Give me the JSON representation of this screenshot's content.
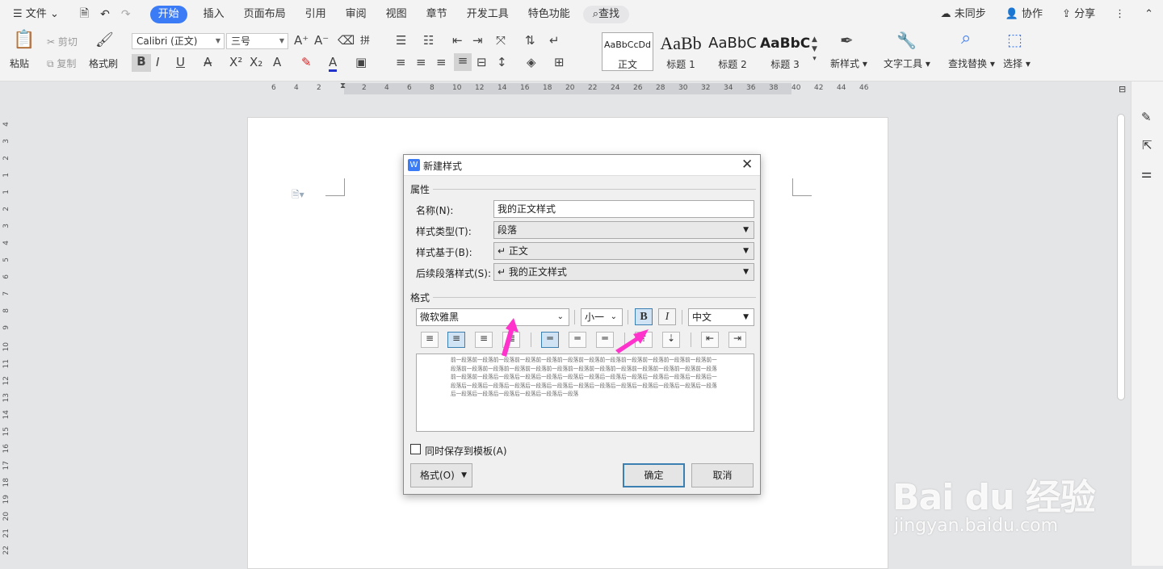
{
  "menubar": {
    "file_label": "文件",
    "tabs": [
      "开始",
      "插入",
      "页面布局",
      "引用",
      "审阅",
      "视图",
      "章节",
      "开发工具",
      "特色功能"
    ],
    "active_tab": "开始",
    "search_label": "查找",
    "sync_label": "未同步",
    "collab_label": "协作",
    "share_label": "分享"
  },
  "ribbon": {
    "paste_label": "粘贴",
    "cut_label": "剪切",
    "copy_label": "复制",
    "format_painter_label": "格式刷",
    "font_name": "Calibri (正文)",
    "font_size": "三号",
    "styles": [
      {
        "preview": "AaBbCcDd",
        "name": "正文"
      },
      {
        "preview": "AaBb",
        "name": "标题 1"
      },
      {
        "preview": "AaBbC",
        "name": "标题 2"
      },
      {
        "preview": "AaBbC",
        "name": "标题 3"
      }
    ],
    "new_style_label": "新样式",
    "text_tools_label": "文字工具",
    "find_replace_label": "查找替换",
    "select_label": "选择"
  },
  "ruler": {
    "h_ticks": [
      "6",
      "4",
      "2",
      "2",
      "4",
      "6",
      "8",
      "10",
      "12",
      "14",
      "16",
      "18",
      "20",
      "22",
      "24",
      "26",
      "28",
      "30",
      "32",
      "34",
      "36",
      "38",
      "40",
      "42",
      "44",
      "46"
    ],
    "v_ticks": [
      "4",
      "3",
      "2",
      "1",
      "1",
      "2",
      "3",
      "4",
      "5",
      "6",
      "7",
      "8",
      "9",
      "10",
      "11",
      "12",
      "13",
      "14",
      "15",
      "16",
      "17",
      "18",
      "19",
      "20",
      "21",
      "22"
    ]
  },
  "dialog": {
    "title": "新建样式",
    "section_properties": "属性",
    "name_label": "名称(N):",
    "name_value": "我的正文样式",
    "type_label": "样式类型(T):",
    "type_value": "段落",
    "based_label": "样式基于(B):",
    "based_value": "↵ 正文",
    "next_label": "后续段落样式(S):",
    "next_value": "↵ 我的正文样式",
    "section_format": "格式",
    "font_value": "微软雅黑",
    "size_value": "小一",
    "bold_label": "B",
    "italic_label": "I",
    "lang_value": "中文",
    "preview_text": "前一段落前一段落前一段落前一段落前一段落前一段落前一段落前一段落前一段落前一段落前一段落前一段落前一段落前一段落前一段落前一段落前一段落前一段落前一段落前一段落前一段落前一段落前一段落前一段落前一段落前一段落前一段落后一段落后一段落后一段落后一段落后一段落后一段落后一段落后一段落后一段落后一段落后一段落后一段落后一段落后一段落后一段落后一段落后一段落后一段落后一段落后一段落后一段落后一段落后一段落后一段落后一段落后一段落后一段落后一段落后一段落",
    "template_checkbox": "同时保存到模板(A)",
    "format_button": "格式(O)",
    "ok_button": "确定",
    "cancel_button": "取消"
  },
  "watermark": {
    "logo": "Bai du 经验",
    "url": "jingyan.baidu.com"
  },
  "colors": {
    "accent": "#3b7cf6",
    "arrow": "#ff33cc"
  }
}
